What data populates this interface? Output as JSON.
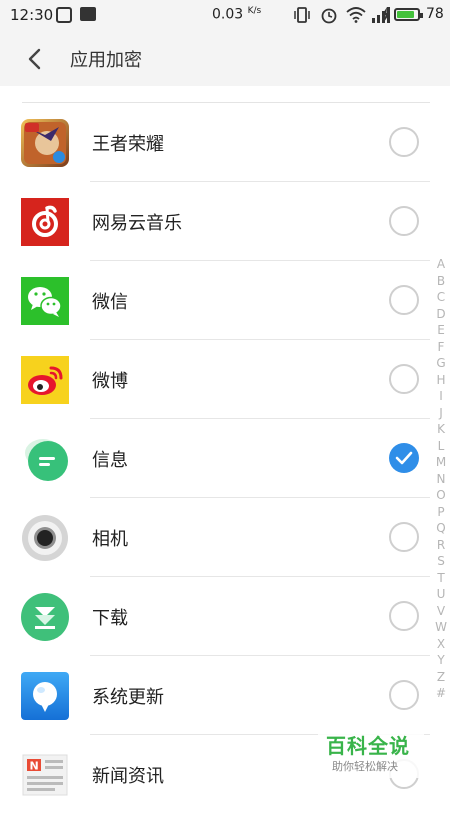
{
  "status_bar": {
    "time": "12:30",
    "speed": "0.03",
    "speed_unit": "K/s",
    "battery_pct": "78",
    "battery_color": "#43c13b"
  },
  "header": {
    "back_icon": "chevron-left-icon",
    "title": "应用加密"
  },
  "apps": [
    {
      "label": "王者荣耀",
      "icon": "honor-of-kings-icon",
      "checked": false
    },
    {
      "label": "网易云音乐",
      "icon": "netease-music-icon",
      "checked": false
    },
    {
      "label": "微信",
      "icon": "wechat-icon",
      "checked": false
    },
    {
      "label": "微博",
      "icon": "weibo-icon",
      "checked": false
    },
    {
      "label": "信息",
      "icon": "messages-icon",
      "checked": true
    },
    {
      "label": "相机",
      "icon": "camera-icon",
      "checked": false
    },
    {
      "label": "下载",
      "icon": "download-icon",
      "checked": false
    },
    {
      "label": "系统更新",
      "icon": "system-update-icon",
      "checked": false
    },
    {
      "label": "新闻资讯",
      "icon": "news-icon",
      "checked": false
    }
  ],
  "alpha_index": [
    "A",
    "B",
    "C",
    "D",
    "E",
    "F",
    "G",
    "H",
    "I",
    "J",
    "K",
    "L",
    "M",
    "N",
    "O",
    "P",
    "Q",
    "R",
    "S",
    "T",
    "U",
    "V",
    "W",
    "X",
    "Y",
    "Z",
    "#"
  ],
  "accent_color": "#2f8ee8",
  "watermark": {
    "title": "百科全说",
    "subtitle": "助你轻松解决"
  }
}
